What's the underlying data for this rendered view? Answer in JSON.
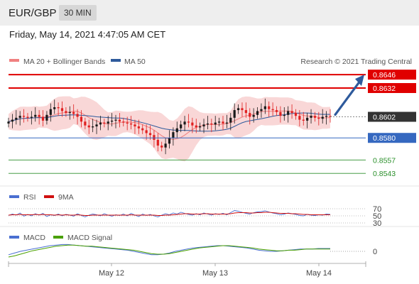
{
  "header": {
    "symbol": "EUR/GBP",
    "timeframe": "30 MIN",
    "datetime": "Friday, May 14, 2021 4:47:05 AM CET"
  },
  "legend": {
    "ma20": "MA 20 + Bollinger Bands",
    "ma50": "MA 50",
    "credit": "Research © 2021 Trading Central",
    "rsi": "RSI",
    "rsi_ma": "9MA",
    "macd": "MACD",
    "macd_signal": "MACD Signal"
  },
  "colors": {
    "resistance": "#e00000",
    "support": "#3568c0",
    "green": "#2a8f2a",
    "pivot": "#333333",
    "band": "#f7c9c9",
    "ma20": "#f08080",
    "ma50": "#2e5a9c",
    "arrow": "#2e5a9c",
    "up": "#1a1a1a",
    "down": "#e02020",
    "rsi": "#4a6fd1",
    "rsi_ma": "#d01010",
    "macd": "#4a6fd1",
    "macd_signal": "#4aa000"
  },
  "chart_data": [
    {
      "type": "candlestick",
      "ylim": [
        0.8535,
        0.8652
      ],
      "x_labels": [
        "May 12",
        "May 13",
        "May 14"
      ],
      "closes": [
        0.8597,
        0.8599,
        0.8601,
        0.8603,
        0.8602,
        0.8601,
        0.8602,
        0.8604,
        0.8602,
        0.8598,
        0.8604,
        0.861,
        0.8612,
        0.8611,
        0.8608,
        0.8606,
        0.8607,
        0.8605,
        0.8602,
        0.8597,
        0.8593,
        0.8591,
        0.8592,
        0.8594,
        0.8596,
        0.8595,
        0.8597,
        0.8598,
        0.8599,
        0.8597,
        0.8596,
        0.8595,
        0.8594,
        0.8592,
        0.859,
        0.8588,
        0.8585,
        0.8583,
        0.8578,
        0.8572,
        0.857,
        0.8574,
        0.858,
        0.8586,
        0.859,
        0.8594,
        0.8597,
        0.8596,
        0.8593,
        0.8591,
        0.8592,
        0.8594,
        0.8595,
        0.8594,
        0.8596,
        0.8597,
        0.8595,
        0.8596,
        0.8601,
        0.8609,
        0.8611,
        0.8609,
        0.8606,
        0.8602,
        0.8604,
        0.8608,
        0.861,
        0.8613,
        0.861,
        0.8609,
        0.8607,
        0.8603,
        0.8604,
        0.8608,
        0.8606,
        0.8603,
        0.8599,
        0.8598,
        0.8601,
        0.8603,
        0.8601,
        0.86,
        0.8602,
        0.8603,
        0.8602
      ],
      "levels": [
        {
          "value": 0.8646,
          "label": "0.8646",
          "kind": "resistance"
        },
        {
          "value": 0.8632,
          "label": "0.8632",
          "kind": "resistance"
        },
        {
          "value": 0.8602,
          "label": "0.8602",
          "kind": "pivot"
        },
        {
          "value": 0.858,
          "label": "0.8580",
          "kind": "support"
        },
        {
          "value": 0.8557,
          "label": "0.8557",
          "kind": "green"
        },
        {
          "value": 0.8543,
          "label": "0.8543",
          "kind": "green"
        }
      ],
      "ma20": "MA 20 + Bollinger Bands",
      "ma50": "MA 50",
      "forecast_arrow": {
        "from": 0.8602,
        "to": 0.8646
      }
    },
    {
      "type": "line",
      "name": "RSI",
      "ylim": [
        30,
        70
      ],
      "ticks": [
        "70",
        "50",
        "30"
      ],
      "series": [
        {
          "name": "RSI",
          "values": [
            51,
            55,
            52,
            58,
            49,
            54,
            50,
            56,
            52,
            57,
            48,
            53,
            51,
            55,
            50,
            54,
            52,
            49,
            56,
            51,
            47,
            52,
            55,
            53,
            50,
            56,
            52,
            49,
            53,
            51,
            55,
            50,
            57,
            52,
            48,
            55,
            51,
            54,
            50,
            47,
            52,
            56,
            53,
            58,
            55,
            60,
            57,
            54,
            52,
            56,
            53,
            58,
            55,
            52,
            56,
            54,
            57,
            53,
            59,
            65,
            63,
            60,
            57,
            55,
            59,
            61,
            62,
            64,
            61,
            58,
            56,
            53,
            55,
            58,
            56,
            54,
            51,
            50,
            54,
            52,
            51,
            53,
            52,
            55,
            54
          ]
        },
        {
          "name": "9MA",
          "values": [
            52,
            53,
            53,
            54,
            53,
            53,
            53,
            54,
            53,
            54,
            53,
            53,
            52,
            53,
            52,
            53,
            52,
            52,
            53,
            52,
            51,
            51,
            52,
            52,
            52,
            52,
            52,
            52,
            52,
            52,
            52,
            52,
            53,
            52,
            52,
            52,
            52,
            52,
            52,
            51,
            51,
            52,
            52,
            53,
            54,
            55,
            56,
            56,
            55,
            55,
            55,
            56,
            56,
            55,
            55,
            55,
            55,
            55,
            56,
            58,
            59,
            59,
            59,
            58,
            58,
            59,
            59,
            60,
            60,
            59,
            58,
            57,
            57,
            57,
            56,
            56,
            55,
            54,
            54,
            53,
            53,
            53,
            53,
            53,
            53
          ]
        }
      ]
    },
    {
      "type": "line",
      "name": "MACD",
      "ticks": [
        "0"
      ],
      "series": [
        {
          "name": "MACD",
          "values": [
            -3,
            -1.5,
            0,
            1,
            2,
            3,
            4,
            5,
            5.5,
            6,
            6,
            5.5,
            5,
            4.5,
            4,
            3.5,
            3,
            2.5,
            2,
            1.5,
            1,
            0,
            -1,
            -2,
            -3,
            -3,
            -2.5,
            -1.5,
            0,
            1,
            2,
            3,
            3.5,
            4,
            4.5,
            5,
            5,
            4.5,
            4,
            3.5,
            3,
            2,
            1,
            0.5,
            0,
            0,
            0.5,
            1,
            1.5,
            2,
            2,
            2,
            2.5,
            2.5,
            2.5
          ]
        },
        {
          "name": "MACD Signal",
          "values": [
            -5,
            -4,
            -2.5,
            -1,
            0.5,
            1.5,
            2.5,
            3.5,
            4.5,
            5,
            5.5,
            5.5,
            5,
            4.5,
            4.5,
            4,
            3.5,
            3,
            2.5,
            2,
            1.5,
            1,
            0,
            -1,
            -2,
            -2.5,
            -2.5,
            -2,
            -1,
            0,
            1,
            2,
            3,
            3.5,
            4,
            4.5,
            5,
            5,
            4.5,
            4,
            3.5,
            3,
            2,
            1.5,
            1,
            0.5,
            0.5,
            1,
            1,
            1.5,
            2,
            2,
            2,
            2,
            2
          ]
        }
      ]
    }
  ]
}
